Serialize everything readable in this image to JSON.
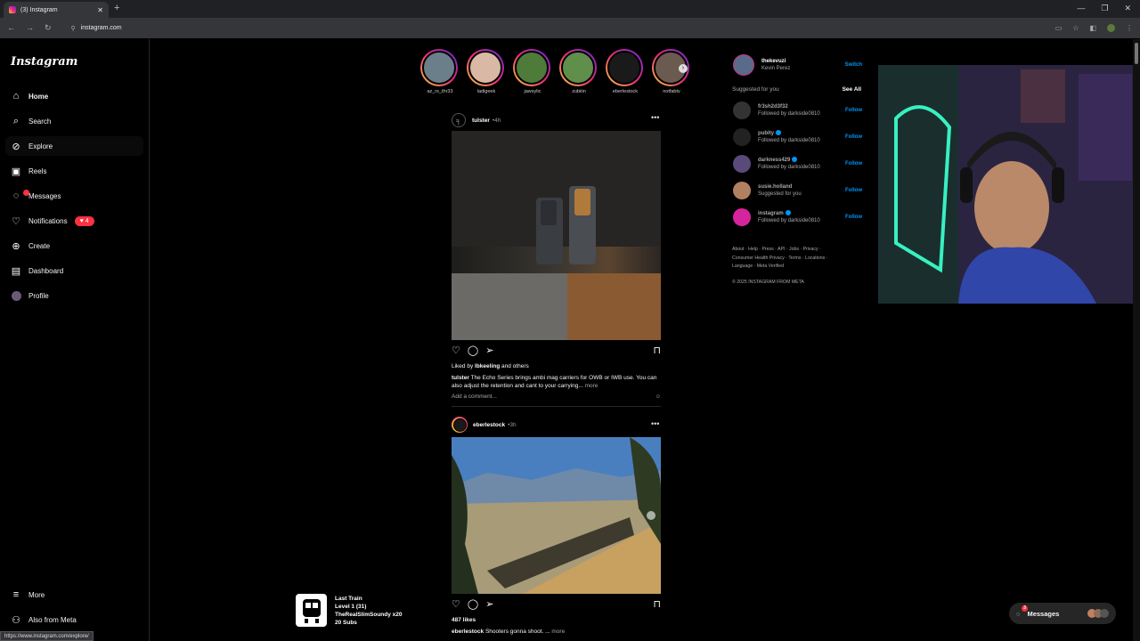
{
  "browser": {
    "tab_title": "(3) Instagram",
    "url": "instagram.com",
    "status_url": "https://www.instagram.com/explore/"
  },
  "sidebar": {
    "logo": "Instagram",
    "items": [
      {
        "label": "Home",
        "icon": "home-icon"
      },
      {
        "label": "Search",
        "icon": "search-icon"
      },
      {
        "label": "Explore",
        "icon": "compass-icon"
      },
      {
        "label": "Reels",
        "icon": "reels-icon"
      },
      {
        "label": "Messages",
        "icon": "messenger-icon"
      },
      {
        "label": "Notifications",
        "icon": "heart-icon",
        "badge": "4"
      },
      {
        "label": "Create",
        "icon": "plus-square-icon"
      },
      {
        "label": "Dashboard",
        "icon": "dashboard-icon"
      },
      {
        "label": "Profile",
        "icon": "avatar"
      }
    ],
    "more": "More",
    "also_from_meta": "Also from Meta"
  },
  "stories": [
    {
      "name": "az_rs_thr33",
      "color": "#6b7f8a"
    },
    {
      "name": "ladigeek",
      "color": "#d9b8a6"
    },
    {
      "name": "jawsylic",
      "color": "#4e7a3a"
    },
    {
      "name": "zubiiin",
      "color": "#5f8f4a"
    },
    {
      "name": "eberlestock",
      "color": "#1a1a1a"
    },
    {
      "name": "notfabtv",
      "color": "#6a5a50"
    }
  ],
  "posts": [
    {
      "user": "tulster",
      "time": "4h",
      "liked_by_prefix": "Liked by ",
      "liked_by_user": "lbkeeling",
      "liked_by_suffix": " and others",
      "caption_user": "tulster",
      "caption": "The Echo Series brings ambi mag carriers for OWB or IWB use. You can also adjust the retention and cant to your carrying...",
      "more": "more",
      "comment_placeholder": "Add a comment..."
    },
    {
      "user": "eberlestock",
      "time": "3h",
      "likes": "487 likes",
      "caption_user": "eberlestock",
      "caption": "Shooters gonna shoot. ...",
      "more": "more"
    }
  ],
  "right": {
    "user": "thekevuzi",
    "full_name": "Kevin Perez",
    "switch": "Switch",
    "suggested_title": "Suggested for you",
    "see_all": "See All",
    "suggestions": [
      {
        "name": "fr3sh2d3f32",
        "sub": "Followed by darkside0810",
        "verified": false,
        "color": "#333"
      },
      {
        "name": "pubity",
        "sub": "Followed by darkside0810",
        "verified": true,
        "color": "#222"
      },
      {
        "name": "darkness429",
        "sub": "Followed by darkside0810",
        "verified": true,
        "color": "#5a4a7a"
      },
      {
        "name": "susie.holland",
        "sub": "Suggested for you",
        "verified": false,
        "color": "#b08060"
      },
      {
        "name": "instagram",
        "sub": "Followed by darkside0810",
        "verified": true,
        "color": "#d6249f"
      }
    ],
    "follow": "Follow",
    "footer_line1": "About · Help · Press · API · Jobs · Privacy ·",
    "footer_line2": "Consumer Health Privacy · Terms · Locations ·",
    "footer_line3": "Language · Meta Verified",
    "copyright": "© 2025 INSTAGRAM FROM META"
  },
  "music": {
    "title": "Last Train",
    "level": "Level 1  (31)",
    "artist": "TheRealSlimSoundy x20",
    "subs": "20 Subs"
  },
  "messages_pill": {
    "label": "Messages",
    "count": "3"
  },
  "colors": {
    "accent": "#0095f6",
    "badge": "#ff3040",
    "background": "#000000"
  }
}
